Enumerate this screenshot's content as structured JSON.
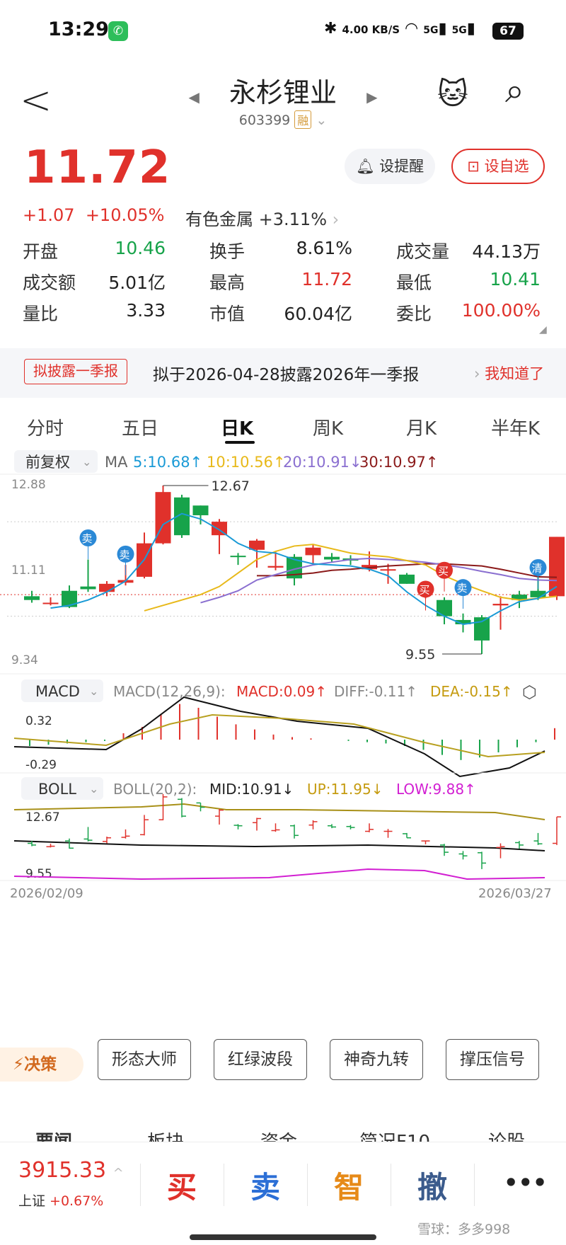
{
  "status": {
    "time": "13:29",
    "net": "4.00 KB/S",
    "signal1": "5G",
    "signal2": "5G",
    "battery": "67"
  },
  "header": {
    "back": "<",
    "title": "永杉锂业",
    "code": "603399",
    "badge": "融",
    "prev": "◀",
    "next": "▶",
    "avatar": "🐱",
    "search": "⌕"
  },
  "quote": {
    "price": "11.72",
    "change": "+1.07",
    "change_pct": "+10.05%",
    "sector": "有色金属",
    "sector_pct": "+3.11%"
  },
  "buttons": {
    "alert": "设提醒",
    "favorite": "设自选"
  },
  "stats": [
    {
      "label": "开盘",
      "value": "10.46",
      "color": "green"
    },
    {
      "label": "换手",
      "value": "8.61%",
      "color": "blk"
    },
    {
      "label": "成交量",
      "value": "44.13万",
      "color": "blk"
    },
    {
      "label": "成交额",
      "value": "5.01亿",
      "color": "blk"
    },
    {
      "label": "最高",
      "value": "11.72",
      "color": "red"
    },
    {
      "label": "最低",
      "value": "10.41",
      "color": "green"
    },
    {
      "label": "量比",
      "value": "3.33",
      "color": "blk"
    },
    {
      "label": "市值",
      "value": "60.04亿",
      "color": "blk"
    },
    {
      "label": "委比",
      "value": "100.00%",
      "color": "red"
    }
  ],
  "notice": {
    "tag": "拟披露一季报",
    "text": "拟于2026-04-28披露2026年一季报",
    "action": "我知道了"
  },
  "tabs": [
    "分时",
    "五日",
    "日K",
    "周K",
    "月K",
    "半年K"
  ],
  "chart_controls": {
    "adj": "前复权",
    "ma_label": "MA",
    "ma5": "5:10.68↑",
    "ma10": "10:10.56↑",
    "ma20": "20:10.91↓",
    "ma30": "30:10.97↑"
  },
  "macd": {
    "name": "MACD",
    "params": "MACD(12,26,9):",
    "macd": "MACD:0.09↑",
    "diff": "DIFF:-0.11↑",
    "dea": "DEA:-0.15↑",
    "ymax": "0.32",
    "ymin": "-0.29"
  },
  "boll": {
    "name": "BOLL",
    "params": "BOLL(20,2):",
    "mid": "MID:10.91↓",
    "up": "UP:11.95↓",
    "low": "LOW:9.88↑",
    "ymax": "12.67",
    "ymin": "9.55"
  },
  "dates": {
    "start": "2026/02/09",
    "end": "2026/03/27"
  },
  "signals": {
    "buy": "买",
    "sell": "卖",
    "clear": "清"
  },
  "chart_data": {
    "type": "candlestick",
    "ylim": [
      9.34,
      12.88
    ],
    "y_tick_labels": [
      "12.88",
      "11.11",
      "9.34"
    ],
    "high_label": "12.67",
    "low_label": "9.55",
    "current_price": 11.72,
    "candles": [
      {
        "o": 10.62,
        "c": 10.55,
        "h": 10.72,
        "l": 10.5
      },
      {
        "o": 10.48,
        "c": 10.5,
        "h": 10.6,
        "l": 10.45
      },
      {
        "o": 10.72,
        "c": 10.42,
        "h": 10.82,
        "l": 10.4
      },
      {
        "o": 10.8,
        "c": 10.75,
        "h": 11.3,
        "l": 10.7
      },
      {
        "o": 10.7,
        "c": 10.85,
        "h": 10.9,
        "l": 10.62
      },
      {
        "o": 10.87,
        "c": 10.92,
        "h": 11.2,
        "l": 10.82
      },
      {
        "o": 10.98,
        "c": 11.6,
        "h": 11.8,
        "l": 10.95
      },
      {
        "o": 11.6,
        "c": 12.55,
        "h": 12.67,
        "l": 11.58
      },
      {
        "o": 12.45,
        "c": 11.75,
        "h": 12.5,
        "l": 11.7
      },
      {
        "o": 12.3,
        "c": 12.12,
        "h": 12.3,
        "l": 11.95
      },
      {
        "o": 11.75,
        "c": 12.0,
        "h": 12.05,
        "l": 11.4
      },
      {
        "o": 11.37,
        "c": 11.35,
        "h": 11.42,
        "l": 11.2
      },
      {
        "o": 11.48,
        "c": 11.65,
        "h": 11.68,
        "l": 11.15
      },
      {
        "o": 11.15,
        "c": 11.18,
        "h": 11.45,
        "l": 11.1
      },
      {
        "o": 11.35,
        "c": 10.95,
        "h": 11.4,
        "l": 10.82
      },
      {
        "o": 11.38,
        "c": 11.52,
        "h": 11.58,
        "l": 11.2
      },
      {
        "o": 11.35,
        "c": 11.3,
        "h": 11.42,
        "l": 11.25
      },
      {
        "o": 11.32,
        "c": 11.28,
        "h": 11.38,
        "l": 11.2
      },
      {
        "o": 11.12,
        "c": 11.2,
        "h": 11.45,
        "l": 11.08
      },
      {
        "o": 11.12,
        "c": 11.12,
        "h": 11.22,
        "l": 10.85
      },
      {
        "o": 11.02,
        "c": 10.85,
        "h": 11.05,
        "l": 10.85
      },
      {
        "o": 10.72,
        "c": 10.72,
        "h": 10.72,
        "l": 10.58
      },
      {
        "o": 10.55,
        "c": 10.25,
        "h": 10.6,
        "l": 10.1
      },
      {
        "o": 10.18,
        "c": 10.1,
        "h": 10.3,
        "l": 9.95
      },
      {
        "o": 10.23,
        "c": 9.8,
        "h": 10.27,
        "l": 9.55
      },
      {
        "o": 10.45,
        "c": 10.48,
        "h": 10.62,
        "l": 10.0
      },
      {
        "o": 10.65,
        "c": 10.55,
        "h": 10.72,
        "l": 10.4
      },
      {
        "o": 10.72,
        "c": 10.6,
        "h": 11.05,
        "l": 10.55
      },
      {
        "o": 10.62,
        "c": 11.72,
        "h": 11.72,
        "l": 10.55
      }
    ],
    "ma5": [
      10.4,
      10.45,
      10.55,
      10.7,
      10.9,
      11.3,
      11.95,
      12.15,
      12.05,
      11.85,
      11.6,
      11.45,
      11.42,
      11.3,
      11.22,
      11.2,
      11.18,
      11.12,
      11.0,
      10.7,
      10.45,
      10.25,
      10.1,
      10.15,
      10.35,
      10.52,
      10.58,
      10.8
    ],
    "ma10": [
      10.35,
      10.45,
      10.55,
      10.65,
      10.8,
      11.05,
      11.3,
      11.45,
      11.55,
      11.58,
      11.5,
      11.42,
      11.38,
      11.35,
      11.28,
      11.2,
      11.0,
      10.85,
      10.72,
      10.6,
      10.55,
      10.58,
      10.62
    ],
    "ma20": [
      10.5,
      10.6,
      10.72,
      10.92,
      11.02,
      11.12,
      11.2,
      11.25,
      11.3,
      11.32,
      11.3,
      11.28,
      11.25,
      11.2,
      11.15,
      11.08,
      11.02,
      10.95,
      10.92,
      10.91
    ],
    "ma30": [
      11.0,
      11.0,
      11.02,
      11.05,
      11.1,
      11.12,
      11.15,
      11.18,
      11.2,
      11.22,
      11.22,
      11.2,
      11.18,
      11.12,
      11.05,
      10.98,
      10.97
    ]
  }
}
